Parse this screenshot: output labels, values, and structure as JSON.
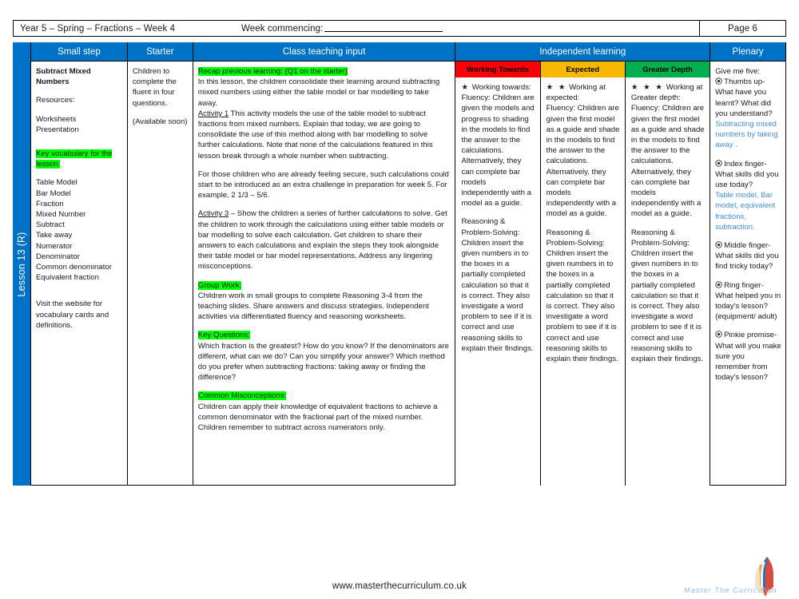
{
  "meta": {
    "title": "Year 5 – Spring – Fractions – Week 4",
    "week_commencing_label": "Week commencing:",
    "page_label": "Page 6"
  },
  "lesson_tab": {
    "label": "Lesson 13 (R)"
  },
  "headers": {
    "small_step": "Small step",
    "starter": "Starter",
    "class_teaching_input": "Class teaching input",
    "independent_learning": "Independent learning",
    "plenary": "Plenary",
    "working_towards": "Working Towards",
    "expected": "Expected",
    "greater_depth": "Greater Depth"
  },
  "colors": {
    "brand_blue": "#0072c6",
    "working_towards": "#fb0007",
    "expected": "#f8b700",
    "greater_depth": "#00b04f",
    "highlight": "#00ff00",
    "answer_blue": "#3f8fd0"
  },
  "small_step": {
    "title": "Subtract Mixed Numbers",
    "resources_label": "Resources:",
    "resources": [
      "Worksheets",
      "Presentation"
    ],
    "key_vocab_heading": "Key vocabulary for the lesson:",
    "vocabulary": [
      "Table Model",
      "Bar Model",
      "Fraction",
      "Mixed Number",
      "Subtract",
      "Take away",
      "Numerator",
      "Denominator",
      "Common denominator",
      "Equivalent fraction"
    ],
    "footer_note": "Visit the website for vocabulary cards and definitions."
  },
  "starter": {
    "text": "Children to complete the fluent in four questions.",
    "availability": "(Available soon)"
  },
  "teaching": {
    "recap_heading": "Recap previous learning: (Q1 on the starter)",
    "recap_text": "In this lesson, the children consolidate their learning around subtracting mixed numbers using  either the table model or bar modelling to take away.",
    "activity1_label": "Activity 1",
    "activity1_text": " This activity models the use of the table model to subtract fractions from mixed numbers. Explain that today, we are going to consolidate the use of this method along with bar modelling to solve further calculations. Note that none of the calculations featured in this lesson break through a whole number when subtracting.",
    "secure_text": "For those children who are already feeling secure, such calculations could start to be introduced as an extra challenge in preparation for week 5. For example, 2 1/3 – 5/6.",
    "activity3_label": "Activity 3",
    "activity3_text": " – Show the children a series of further calculations to solve. Get the children to work through the calculations using either table models or bar modelling to solve each calculation. Get children to share their answers to each calculations and explain the steps they took alongside their table model or bar model representations. Address any lingering misconceptions.",
    "group_work_heading": "Group Work:",
    "group_work_text": "Children work in small groups to complete Reasoning 3-4 from the teaching slides. Share answers and discuss strategies. Independent activities via differentiated fluency and reasoning worksheets.",
    "key_questions_heading": "Key Questions:",
    "key_questions_text": "Which fraction is the greatest? How do you know? If the denominators are different, what can we do? Can you simplify your answer? Which method do you prefer when subtracting fractions: taking away or finding the difference?",
    "misconceptions_heading": "Common Misconceptions:",
    "misconceptions_text_1": "Children can apply their knowledge of equivalent fractions to achieve a common denominator with the fractional part of the mixed number.",
    "misconceptions_text_2": "Children remember to subtract across numerators only."
  },
  "independent": {
    "working_towards": {
      "stars": "★",
      "heading": "Working towards:",
      "fluency": "Fluency: Children are given the models and progress to shading in the models to find the answer to the calculations. Alternatively, they can complete bar models independently with a model as a guide.",
      "reasoning_heading": "Reasoning & Problem-Solving:",
      "reasoning": "Children insert the given numbers in to the boxes in a partially completed calculation so that it is correct. They also investigate a word problem  to see if it is correct and use reasoning skills to explain their findings."
    },
    "expected": {
      "stars": "★ ★",
      "heading": "Working at expected:",
      "fluency": "Fluency: Children are given the first model as a guide and shade in the models to find the answer to the calculations. Alternatively, they can complete bar models independently with a model as a guide.",
      "reasoning_heading": "Reasoning & Problem-Solving:",
      "reasoning": "Children insert the given numbers in to the boxes in a partially completed calculation so that it is correct. They also investigate a word problem  to see if it is correct and use reasoning skills to explain their findings."
    },
    "greater_depth": {
      "stars": "★ ★ ★",
      "heading": "Working at Greater depth:",
      "fluency": "Fluency: Children are given the first model as a guide and shade in the models to find the answer to the calculations. Alternatively, they can complete bar models independently with a model as a guide.",
      "reasoning_heading": "Reasoning & Problem-Solving:",
      "reasoning": "Children insert the given numbers in to the boxes in a partially completed calculation so that it is correct. They also investigate a word problem  to see if it is correct and use reasoning skills to explain their findings."
    }
  },
  "plenary": {
    "intro": "Give me five:",
    "items": [
      {
        "icon": "hand-icon",
        "question": "Thumbs up- What have you learnt? What did you understand?",
        "answer": "Subtracting mixed numbers by taking away ."
      },
      {
        "icon": "hand-icon",
        "question": "Index finger- What skills did you use today?",
        "answer": "Table model, Bar model, equivalent fractions, subtraction."
      },
      {
        "icon": "hand-icon",
        "question": "Middle finger- What skills did you find tricky today?",
        "answer": ""
      },
      {
        "icon": "hand-icon",
        "question": "Ring finger- What helped you in today's lesson? (equipment/ adult)",
        "answer": ""
      },
      {
        "icon": "hand-icon",
        "question": "Pinkie promise- What will you make sure you remember from today's lesson?",
        "answer": ""
      }
    ]
  },
  "footer": {
    "url": "www.masterthecurriculum.co.uk",
    "logo_text": "Master  The  Curriculum"
  }
}
